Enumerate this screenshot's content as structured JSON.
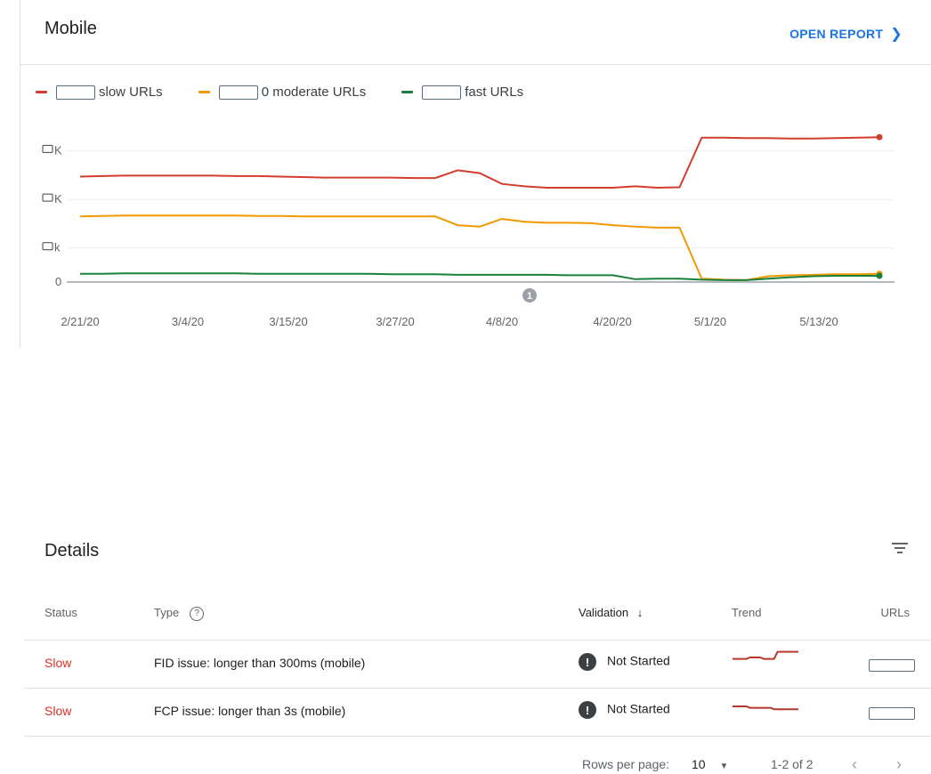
{
  "card": {
    "title": "Mobile",
    "open_report_label": "OPEN REPORT",
    "open_report_icon": "chevron-right-icon"
  },
  "legend": [
    {
      "label": "slow URLs",
      "color": "#d33c2e"
    },
    {
      "label": "0 moderate URLs",
      "color": "#f29900"
    },
    {
      "label": "fast URLs",
      "color": "#188038"
    }
  ],
  "chart_data": {
    "type": "line",
    "x_ticks": [
      "2/21/20",
      "3/4/20",
      "3/15/20",
      "3/27/20",
      "4/8/20",
      "4/20/20",
      "5/1/20",
      "5/13/20"
    ],
    "y_ticks": [
      "K",
      "K",
      "k",
      "0"
    ],
    "annotation": "1",
    "x": [
      "2/21/20",
      "2/24/20",
      "2/27/20",
      "3/1/20",
      "3/4/20",
      "3/7/20",
      "3/10/20",
      "3/13/20",
      "3/16/20",
      "3/19/20",
      "3/22/20",
      "3/25/20",
      "3/28/20",
      "3/31/20",
      "4/3/20",
      "4/6/20",
      "4/9/20",
      "4/10/20",
      "4/11/20",
      "4/12/20",
      "4/13/20",
      "4/15/20",
      "4/17/20",
      "4/20/20",
      "4/23/20",
      "4/25/20",
      "4/26/20",
      "4/28/20",
      "4/29/20",
      "5/1/20",
      "5/4/20",
      "5/7/20",
      "5/10/20",
      "5/13/20",
      "5/16/20",
      "5/19/20",
      "5/22/20"
    ],
    "series": [
      {
        "name": "slow URLs",
        "color": "#d33c2e",
        "values": [
          2.15,
          2.16,
          2.17,
          2.17,
          2.17,
          2.17,
          2.17,
          2.16,
          2.16,
          2.15,
          2.14,
          2.13,
          2.13,
          2.13,
          2.13,
          2.12,
          2.12,
          2.28,
          2.22,
          2.0,
          1.95,
          1.92,
          1.92,
          1.92,
          1.92,
          1.95,
          1.92,
          1.93,
          2.95,
          2.95,
          2.94,
          2.94,
          2.93,
          2.93,
          2.94,
          2.95,
          2.96
        ]
      },
      {
        "name": "0 moderate URLs",
        "color": "#f29900",
        "values": [
          1.33,
          1.34,
          1.35,
          1.35,
          1.35,
          1.35,
          1.35,
          1.35,
          1.34,
          1.34,
          1.33,
          1.33,
          1.33,
          1.33,
          1.33,
          1.33,
          1.33,
          1.15,
          1.12,
          1.28,
          1.22,
          1.2,
          1.2,
          1.19,
          1.15,
          1.12,
          1.1,
          1.1,
          0.05,
          0.03,
          0.02,
          0.1,
          0.12,
          0.13,
          0.14,
          0.14,
          0.15
        ]
      },
      {
        "name": "fast URLs",
        "color": "#188038",
        "values": [
          0.15,
          0.15,
          0.16,
          0.16,
          0.16,
          0.16,
          0.16,
          0.16,
          0.15,
          0.15,
          0.15,
          0.15,
          0.15,
          0.15,
          0.14,
          0.14,
          0.14,
          0.13,
          0.13,
          0.13,
          0.13,
          0.13,
          0.12,
          0.12,
          0.12,
          0.04,
          0.05,
          0.05,
          0.03,
          0.02,
          0.02,
          0.05,
          0.08,
          0.1,
          0.11,
          0.11,
          0.11
        ]
      }
    ],
    "ylim": [
      0,
      3.0
    ]
  },
  "details": {
    "title": "Details",
    "filter_icon": "filter-icon",
    "columns": {
      "status": "Status",
      "type": "Type",
      "validation": "Validation",
      "trend": "Trend",
      "urls": "URLs"
    },
    "rows": [
      {
        "status": "Slow",
        "type": "FID issue: longer than 300ms (mobile)",
        "validation": "Not Started",
        "trend": [
          0.6,
          0.6,
          0.6,
          0.6,
          0.6,
          0.5,
          0.5,
          0.5,
          0.5,
          0.6,
          0.6,
          0.6,
          0.6,
          0.1,
          0.1,
          0.1,
          0.1,
          0.1,
          0.1,
          0.1
        ]
      },
      {
        "status": "Slow",
        "type": "FCP issue: longer than 3s (mobile)",
        "validation": "Not Started",
        "trend": [
          0.5,
          0.5,
          0.5,
          0.5,
          0.5,
          0.6,
          0.6,
          0.6,
          0.6,
          0.6,
          0.6,
          0.6,
          0.7,
          0.7,
          0.7,
          0.7,
          0.7,
          0.7,
          0.7,
          0.7
        ]
      }
    ],
    "footer": {
      "rows_per_page_label": "Rows per page:",
      "rows_per_page_value": "10",
      "range": "1-2 of 2"
    }
  }
}
